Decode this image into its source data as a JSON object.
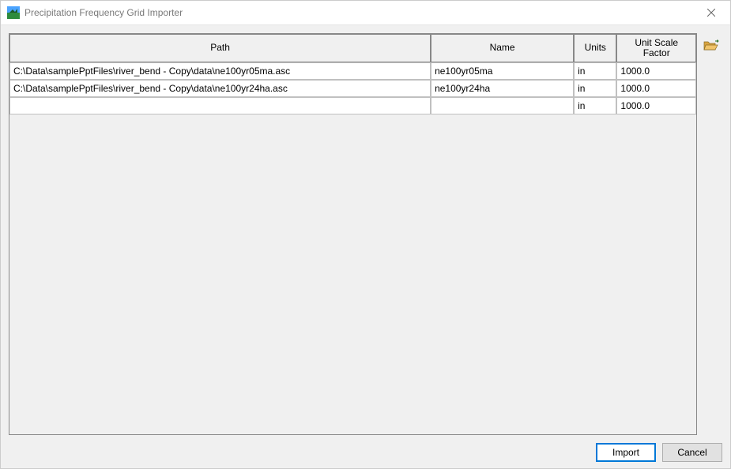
{
  "window": {
    "title": "Precipitation Frequency Grid Importer"
  },
  "table": {
    "headers": {
      "path": "Path",
      "name": "Name",
      "units": "Units",
      "scale": "Unit Scale Factor"
    },
    "rows": [
      {
        "path": "C:\\Data\\samplePptFiles\\river_bend - Copy\\data\\ne100yr05ma.asc",
        "name": "ne100yr05ma",
        "units": "in",
        "scale": "1000.0"
      },
      {
        "path": "C:\\Data\\samplePptFiles\\river_bend - Copy\\data\\ne100yr24ha.asc",
        "name": "ne100yr24ha",
        "units": "in",
        "scale": "1000.0"
      },
      {
        "path": "",
        "name": "",
        "units": "in",
        "scale": "1000.0"
      }
    ]
  },
  "buttons": {
    "import": "Import",
    "cancel": "Cancel"
  },
  "icons": {
    "app": "app-icon",
    "close": "close-icon",
    "open": "folder-open-icon"
  }
}
